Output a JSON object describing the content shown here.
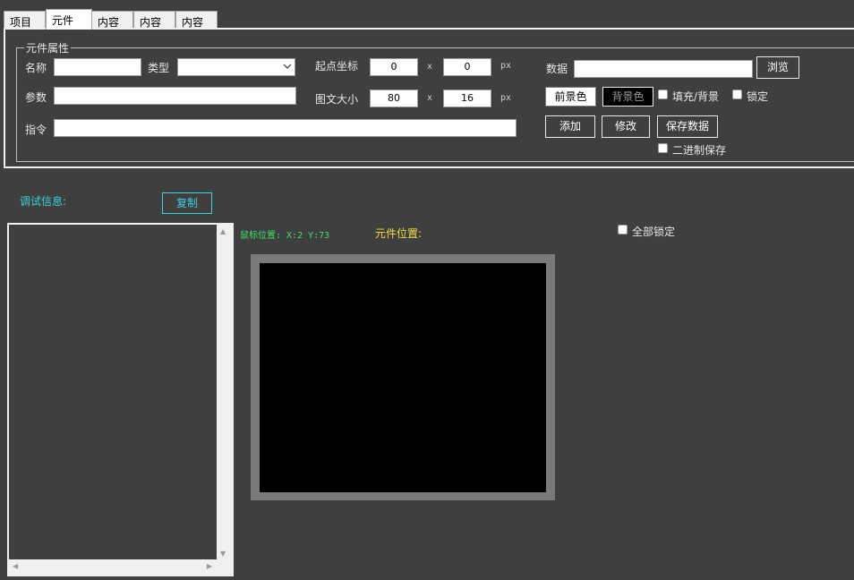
{
  "tabs": [
    "项目",
    "元件",
    "内容",
    "内容",
    "内容"
  ],
  "group": {
    "legend": "元件属性",
    "name_label": "名称",
    "name_value": "",
    "type_label": "类型",
    "type_value": "",
    "origin_label": "起点坐标",
    "origin_x": "0",
    "origin_y": "0",
    "x_sep": "x",
    "px_unit": "px",
    "data_label": "数据",
    "data_value": "",
    "browse_label": "浏览",
    "param_label": "参数",
    "param_value": "",
    "size_label": "图文大小",
    "size_w": "80",
    "size_h": "16",
    "fg_label": "前景色",
    "bg_label": "背景色",
    "fill_label": "填充/背景",
    "lock_label": "锁定",
    "cmd_label": "指令",
    "cmd_value": "",
    "add_label": "添加",
    "modify_label": "修改",
    "save_label": "保存数据",
    "binary_label": "二进制保存"
  },
  "debug": {
    "label": "调试信息:",
    "copy_label": "复制"
  },
  "status": {
    "mouse_pos": "鼠标位置:  X:2 Y:73",
    "elem_pos": "元件位置:"
  },
  "lock_all_label": "全部锁定",
  "colors": {
    "background": "#3f3f3f",
    "accent_cyan": "#3ad3e0",
    "status_green": "#3ae06a",
    "status_yellow": "#f0e040",
    "canvas": "#000000"
  }
}
